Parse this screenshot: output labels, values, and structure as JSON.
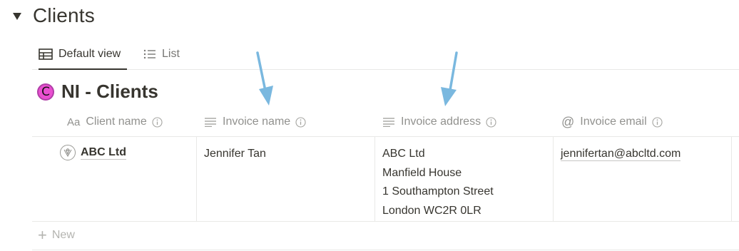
{
  "section": {
    "title": "Clients"
  },
  "tabs": [
    {
      "label": "Default view",
      "icon": "table-icon",
      "active": true
    },
    {
      "label": "List",
      "icon": "list-icon",
      "active": false
    }
  ],
  "database": {
    "icon_letter": "C",
    "title": "NI - Clients",
    "icon_color": "#e94fd0"
  },
  "columns": [
    {
      "type_icon": "Aa",
      "label": "Client name"
    },
    {
      "type_icon": "text-lines-icon",
      "label": "Invoice name"
    },
    {
      "type_icon": "text-lines-icon",
      "label": "Invoice address"
    },
    {
      "type_icon": "@",
      "label": "Invoice email"
    }
  ],
  "rows": [
    {
      "client_name": "ABC Ltd",
      "invoice_name": "Jennifer Tan",
      "invoice_address": [
        "ABC Ltd",
        "Manfield House",
        "1 Southampton Street",
        "London WC2R 0LR"
      ],
      "invoice_email": "jennifertan@abcltd.com"
    }
  ],
  "new_row": {
    "label": "New"
  },
  "annotation_color": "#7ab8df"
}
